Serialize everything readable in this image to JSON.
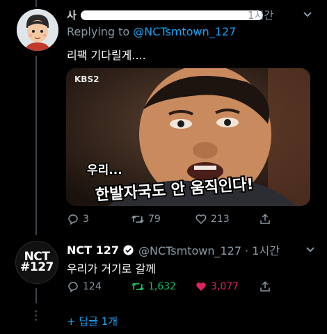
{
  "tweet1": {
    "name_visible": "사",
    "time": "1시간",
    "replying_prefix": "Replying to",
    "replying_handle": "@NCTsmtown_127",
    "text": "리팩 기다릴게....",
    "media": {
      "channel_logo": "KBS2",
      "caption_line1": "우리...",
      "caption_line2": "한발자국도 안 움직인다!"
    },
    "actions": {
      "reply_count": "3",
      "retweet_count": "79",
      "like_count": "213"
    }
  },
  "tweet2": {
    "name": "NCT 127",
    "handle_time": "@NCTsmtown_127 · 1시간",
    "text": "우리가 거기로 갈께",
    "avatar_logo_line1": "NCT",
    "avatar_logo_line2": "#127",
    "actions": {
      "reply_count": "124",
      "retweet_count": "1,632",
      "like_count": "3,077"
    },
    "colors": {
      "retweet_active": "#17bf63",
      "like_active": "#e0245e"
    }
  },
  "more_replies": "+ 답글 1개",
  "colors": {
    "accent": "#1da1f2",
    "muted": "#8899a6",
    "background": "#000000"
  }
}
